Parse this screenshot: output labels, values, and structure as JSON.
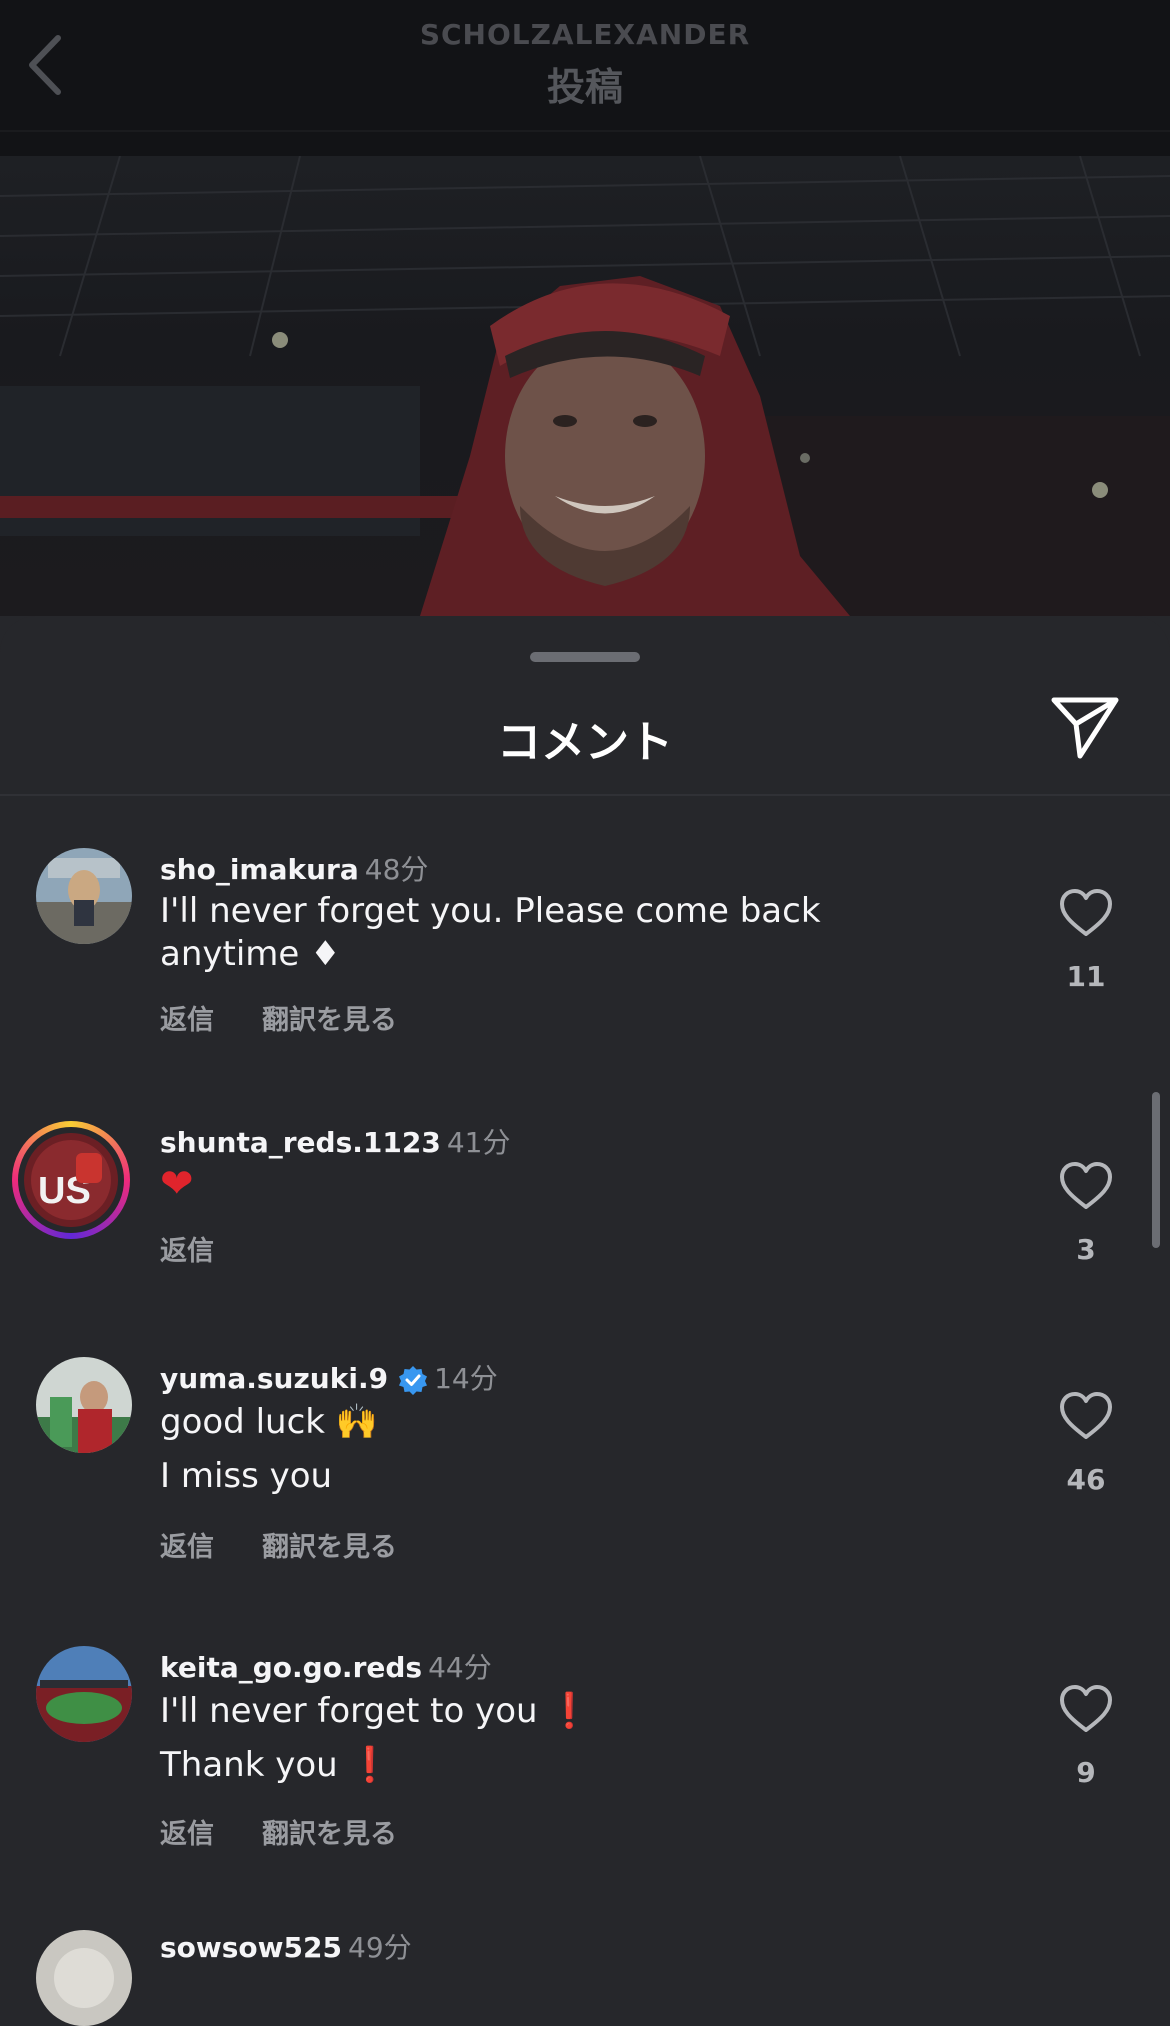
{
  "header": {
    "username": "SCHOLZALEXANDER",
    "title": "投稿"
  },
  "sheet": {
    "title": "コメント"
  },
  "comments": [
    {
      "username": "sho_imakura",
      "time": "48分",
      "text_line1": "I'll never forget you. Please come back",
      "text_line2": "anytime ♦",
      "reply": "返信",
      "translate": "翻訳を見る",
      "likes": "11"
    },
    {
      "username": "shunta_reds.1123",
      "time": "41分",
      "text_line1": "❤",
      "reply": "返信",
      "likes": "3"
    },
    {
      "username": "yuma.suzuki.9",
      "verified": true,
      "time": "14分",
      "text_line1": "good luck 🙌",
      "text_line2": "I miss you",
      "reply": "返信",
      "translate": "翻訳を見る",
      "likes": "46"
    },
    {
      "username": "keita_go.go.reds",
      "time": "44分",
      "text_line1": "I'll never forget to you ❗",
      "text_line2": "Thank you ❗",
      "reply": "返信",
      "translate": "翻訳を見る",
      "likes": "9"
    },
    {
      "username": "sowsow525",
      "time": "49分"
    }
  ],
  "colors": {
    "sheet_bg": "#26272b",
    "accent_verified": "#3897f0",
    "heart_red": "#e0242c"
  },
  "icons": [
    "back-chevron-icon",
    "share-send-icon",
    "heart-outline-icon",
    "verified-badge-icon"
  ]
}
